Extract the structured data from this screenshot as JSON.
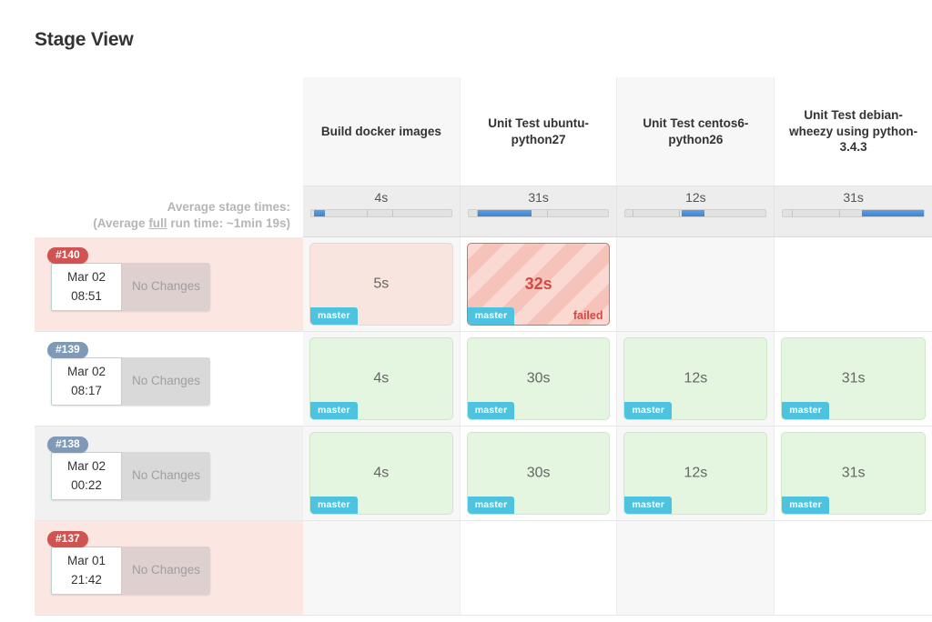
{
  "page": {
    "title": "Stage View"
  },
  "average": {
    "line1": "Average stage times:",
    "line2_prefix": "(Average ",
    "line2_underline": "full",
    "line2_suffix": " run time: ~1min 19s)"
  },
  "stages": [
    {
      "name": "Build docker images",
      "avg_time": "4s",
      "bar": {
        "start_pct": 2,
        "width_pct": 8
      }
    },
    {
      "name": "Unit Test ubuntu-python27",
      "avg_time": "31s",
      "bar": {
        "start_pct": 7,
        "width_pct": 38
      }
    },
    {
      "name": "Unit Test centos6-python26",
      "avg_time": "12s",
      "bar": {
        "start_pct": 40,
        "width_pct": 16
      }
    },
    {
      "name": "Unit Test debian-wheezy using python-3.4.3",
      "avg_time": "31s",
      "bar": {
        "start_pct": 56,
        "width_pct": 44
      }
    }
  ],
  "builds": [
    {
      "number": "#140",
      "badge_color": "red",
      "row_state": "failed",
      "date": "Mar 02",
      "time": "08:51",
      "changes": "No Changes",
      "cells": [
        {
          "status": "unstable",
          "time": "5s",
          "branch": "master",
          "label": ""
        },
        {
          "status": "failed",
          "time": "32s",
          "branch": "master",
          "label": "failed"
        },
        {
          "status": "empty",
          "time": "",
          "branch": "",
          "label": ""
        },
        {
          "status": "empty",
          "time": "",
          "branch": "",
          "label": ""
        }
      ]
    },
    {
      "number": "#139",
      "badge_color": "blue",
      "row_state": "success",
      "date": "Mar 02",
      "time": "08:17",
      "changes": "No Changes",
      "cells": [
        {
          "status": "success",
          "time": "4s",
          "branch": "master",
          "label": ""
        },
        {
          "status": "success",
          "time": "30s",
          "branch": "master",
          "label": ""
        },
        {
          "status": "success",
          "time": "12s",
          "branch": "master",
          "label": ""
        },
        {
          "status": "success",
          "time": "31s",
          "branch": "master",
          "label": ""
        }
      ]
    },
    {
      "number": "#138",
      "badge_color": "blue",
      "row_state": "alt",
      "date": "Mar 02",
      "time": "00:22",
      "changes": "No Changes",
      "cells": [
        {
          "status": "success",
          "time": "4s",
          "branch": "master",
          "label": ""
        },
        {
          "status": "success",
          "time": "30s",
          "branch": "master",
          "label": ""
        },
        {
          "status": "success",
          "time": "12s",
          "branch": "master",
          "label": ""
        },
        {
          "status": "success",
          "time": "31s",
          "branch": "master",
          "label": ""
        }
      ]
    },
    {
      "number": "#137",
      "badge_color": "red",
      "row_state": "failed",
      "date": "Mar 01",
      "time": "21:42",
      "changes": "No Changes",
      "cells": [
        {
          "status": "empty",
          "time": "",
          "branch": "",
          "label": ""
        },
        {
          "status": "empty",
          "time": "",
          "branch": "",
          "label": ""
        },
        {
          "status": "empty",
          "time": "",
          "branch": "",
          "label": ""
        },
        {
          "status": "empty",
          "time": "",
          "branch": "",
          "label": ""
        }
      ]
    }
  ],
  "colors": {
    "badge_red": "#cf5350",
    "badge_blue": "#7e9ab6",
    "branch_badge": "#4ec3e0",
    "failed_text": "#cf4b45",
    "success_cell": "#e4f5e0",
    "bar_fill": "#4a90d9"
  }
}
